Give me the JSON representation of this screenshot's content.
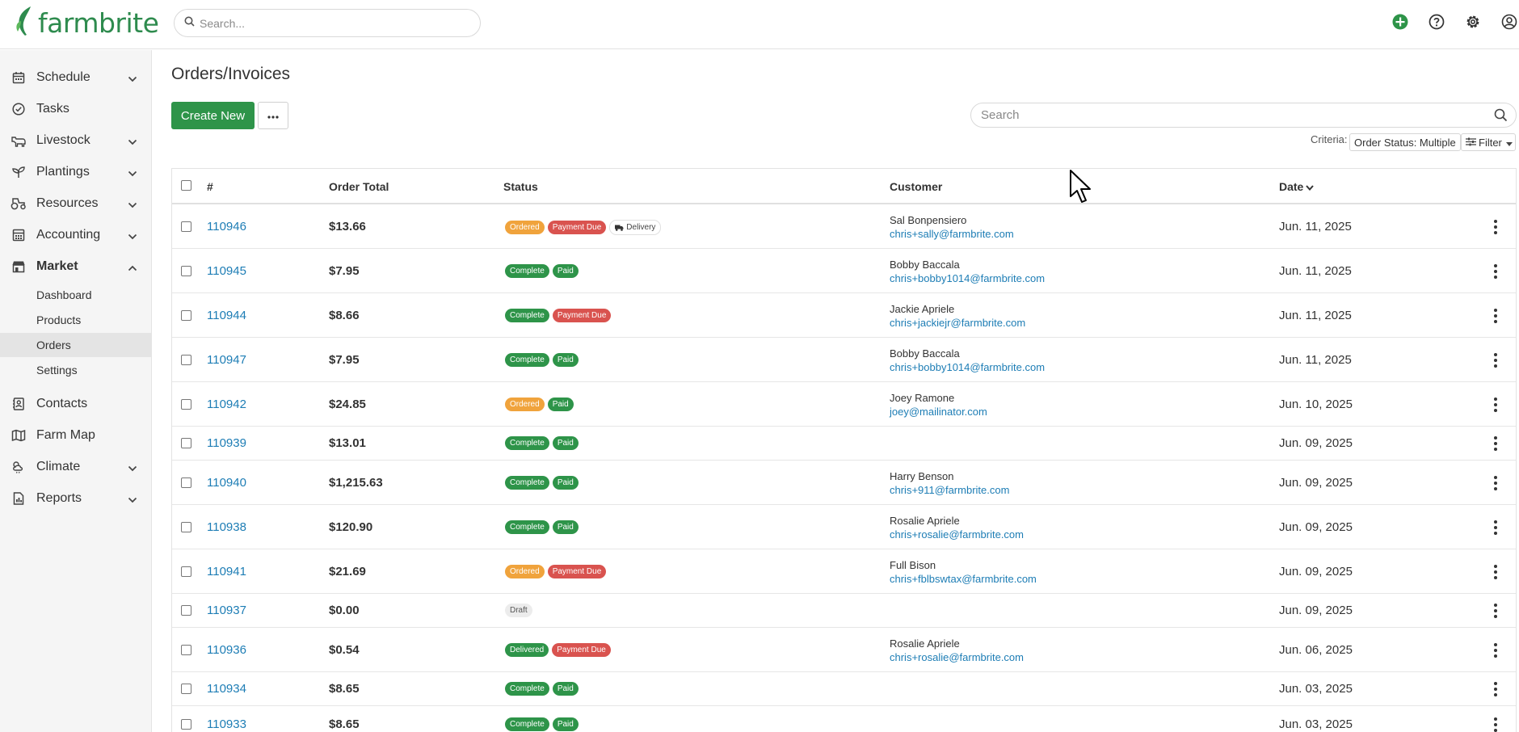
{
  "app": {
    "logo_text": "farmbrite",
    "brand_color": "#2e8b4e"
  },
  "header": {
    "search_placeholder": "Search...",
    "icons": [
      "add-circle-icon",
      "help-icon",
      "gear-icon",
      "user-circle-icon"
    ]
  },
  "sidebar": {
    "items": [
      {
        "label": "Schedule",
        "icon": "calendar-icon",
        "expandable": true
      },
      {
        "label": "Tasks",
        "icon": "check-circle-icon",
        "expandable": false
      },
      {
        "label": "Livestock",
        "icon": "livestock-icon",
        "expandable": true
      },
      {
        "label": "Plantings",
        "icon": "sprout-icon",
        "expandable": true
      },
      {
        "label": "Resources",
        "icon": "tractor-icon",
        "expandable": true
      },
      {
        "label": "Accounting",
        "icon": "calculator-icon",
        "expandable": true
      },
      {
        "label": "Market",
        "icon": "store-icon",
        "expandable": true,
        "expanded": true
      },
      {
        "label": "Contacts",
        "icon": "contact-book-icon",
        "expandable": false
      },
      {
        "label": "Farm Map",
        "icon": "map-icon",
        "expandable": false
      },
      {
        "label": "Climate",
        "icon": "climate-icon",
        "expandable": true
      },
      {
        "label": "Reports",
        "icon": "report-icon",
        "expandable": true
      }
    ],
    "market_sub": [
      "Dashboard",
      "Products",
      "Orders",
      "Settings"
    ],
    "active_sub": "Orders"
  },
  "main": {
    "title": "Orders/Invoices",
    "create_label": "Create New",
    "search_placeholder": "Search",
    "criteria_label": "Criteria:",
    "criteria_value": "Order Status: Multiple",
    "filter_label": "Filter"
  },
  "table": {
    "headers": {
      "num": "#",
      "total": "Order Total",
      "status": "Status",
      "customer": "Customer",
      "date": "Date"
    },
    "rows": [
      {
        "num": "110946",
        "total": "$13.66",
        "status": [
          "Ordered",
          "Payment Due",
          "Delivery"
        ],
        "name": "Sal Bonpensiero",
        "email": "chris+sally@farmbrite.com",
        "date": "Jun. 11, 2025"
      },
      {
        "num": "110945",
        "total": "$7.95",
        "status": [
          "Complete",
          "Paid"
        ],
        "name": "Bobby Baccala",
        "email": "chris+bobby1014@farmbrite.com",
        "date": "Jun. 11, 2025"
      },
      {
        "num": "110944",
        "total": "$8.66",
        "status": [
          "Complete",
          "Payment Due"
        ],
        "name": "Jackie Apriele",
        "email": "chris+jackiejr@farmbrite.com",
        "date": "Jun. 11, 2025"
      },
      {
        "num": "110947",
        "total": "$7.95",
        "status": [
          "Complete",
          "Paid"
        ],
        "name": "Bobby Baccala",
        "email": "chris+bobby1014@farmbrite.com",
        "date": "Jun. 11, 2025"
      },
      {
        "num": "110942",
        "total": "$24.85",
        "status": [
          "Ordered",
          "Paid"
        ],
        "name": "Joey Ramone",
        "email": "joey@mailinator.com",
        "date": "Jun. 10, 2025"
      },
      {
        "num": "110939",
        "total": "$13.01",
        "status": [
          "Complete",
          "Paid"
        ],
        "name": "",
        "email": "",
        "date": "Jun. 09, 2025"
      },
      {
        "num": "110940",
        "total": "$1,215.63",
        "status": [
          "Complete",
          "Paid"
        ],
        "name": "Harry Benson",
        "email": "chris+911@farmbrite.com",
        "date": "Jun. 09, 2025"
      },
      {
        "num": "110938",
        "total": "$120.90",
        "status": [
          "Complete",
          "Paid"
        ],
        "name": "Rosalie Apriele",
        "email": "chris+rosalie@farmbrite.com",
        "date": "Jun. 09, 2025"
      },
      {
        "num": "110941",
        "total": "$21.69",
        "status": [
          "Ordered",
          "Payment Due"
        ],
        "name": "Full Bison",
        "email": "chris+fblbswtax@farmbrite.com",
        "date": "Jun. 09, 2025"
      },
      {
        "num": "110937",
        "total": "$0.00",
        "status": [
          "Draft"
        ],
        "name": "",
        "email": "",
        "date": "Jun. 09, 2025"
      },
      {
        "num": "110936",
        "total": "$0.54",
        "status": [
          "Delivered",
          "Payment Due"
        ],
        "name": "Rosalie Apriele",
        "email": "chris+rosalie@farmbrite.com",
        "date": "Jun. 06, 2025"
      },
      {
        "num": "110934",
        "total": "$8.65",
        "status": [
          "Complete",
          "Paid"
        ],
        "name": "",
        "email": "",
        "date": "Jun. 03, 2025"
      },
      {
        "num": "110933",
        "total": "$8.65",
        "status": [
          "Complete",
          "Paid"
        ],
        "name": "",
        "email": "",
        "date": "Jun. 03, 2025"
      }
    ]
  },
  "colors": {
    "primary_green": "#2e9449",
    "ordered": "#f0a33c",
    "payment_due": "#d9534f",
    "link": "#1d7db5"
  }
}
